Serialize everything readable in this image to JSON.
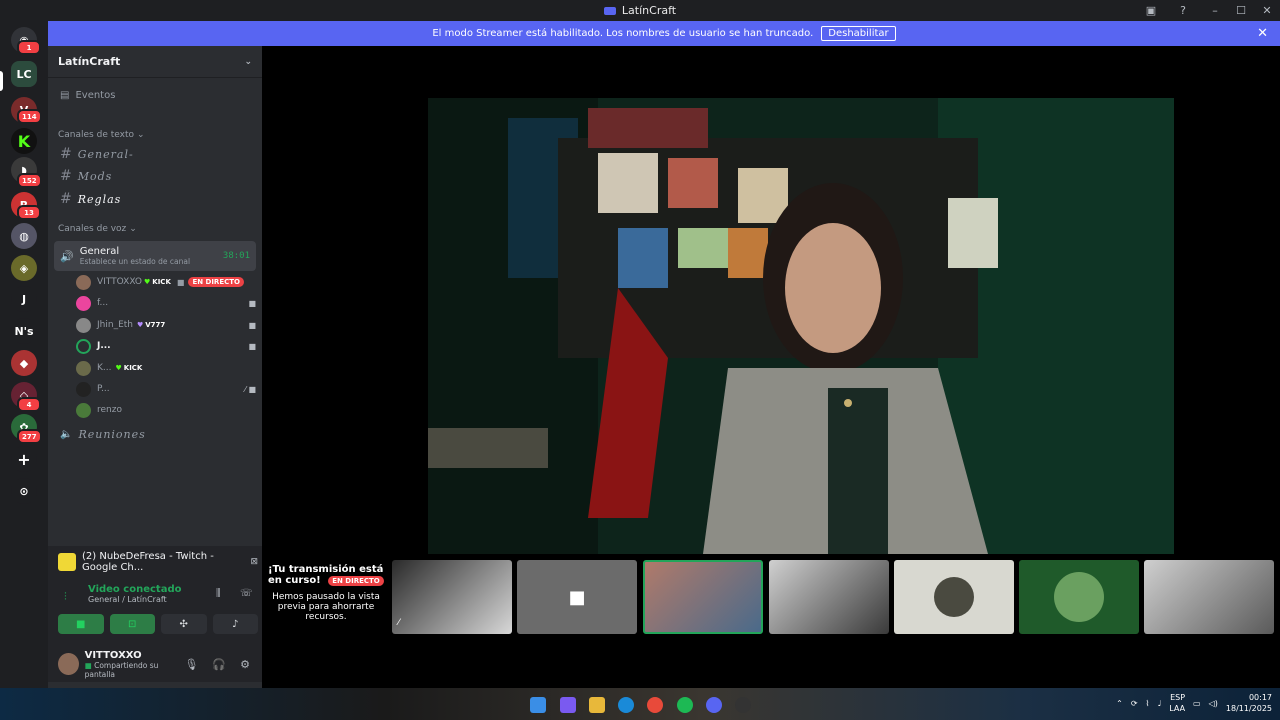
{
  "window": {
    "title": "LatínCraft"
  },
  "banner": {
    "text": "El modo Streamer está habilitado. Los nombres de usuario se han truncado.",
    "button": "Deshabilitar"
  },
  "servers": {
    "badges": [
      "1",
      "114",
      "152",
      "13",
      "4",
      "277"
    ],
    "letter_items": [
      "J",
      "N's"
    ]
  },
  "sidebar": {
    "server_name": "LatínCraft",
    "events": "Eventos",
    "text_category": "Canales de texto",
    "text_channels": [
      "General-",
      "Mods",
      "Reglas"
    ],
    "voice_category": "Canales de voz",
    "voice_channel": {
      "name": "General",
      "timer": "38:01",
      "status": "Establece un estado de canal"
    },
    "voice_users": [
      {
        "name": "VITTOXXO",
        "tag": "KICK",
        "live": "EN DIRECTO"
      },
      {
        "name": "f..."
      },
      {
        "name": "Jhin_Eth",
        "tag": "V777"
      },
      {
        "name": "J..."
      },
      {
        "name": "K...",
        "tag": "KICK"
      },
      {
        "name": "P..."
      },
      {
        "name": "renzo"
      }
    ],
    "other_voice": "Reuniones"
  },
  "stream_card": {
    "title": "(2) NubeDeFresa - Twitch - Google Ch...",
    "video_status": "Video conectado",
    "location": "General / LatínCraft"
  },
  "userbar": {
    "name": "VITTOXXO",
    "status": "Compartiendo su pantalla"
  },
  "strip": {
    "transmission_title": "¡Tu transmisión está en curso!",
    "live": "EN DIRECTO",
    "paused_text": "Hemos pausado la vista previa para ahorrarte recursos."
  },
  "tray": {
    "lang": "ESP",
    "lang2": "LAA",
    "time": "00:17",
    "date": "18/11/2025"
  },
  "colors": {
    "accent": "#5865f2",
    "live": "#ed4245",
    "connected": "#23a55a"
  }
}
